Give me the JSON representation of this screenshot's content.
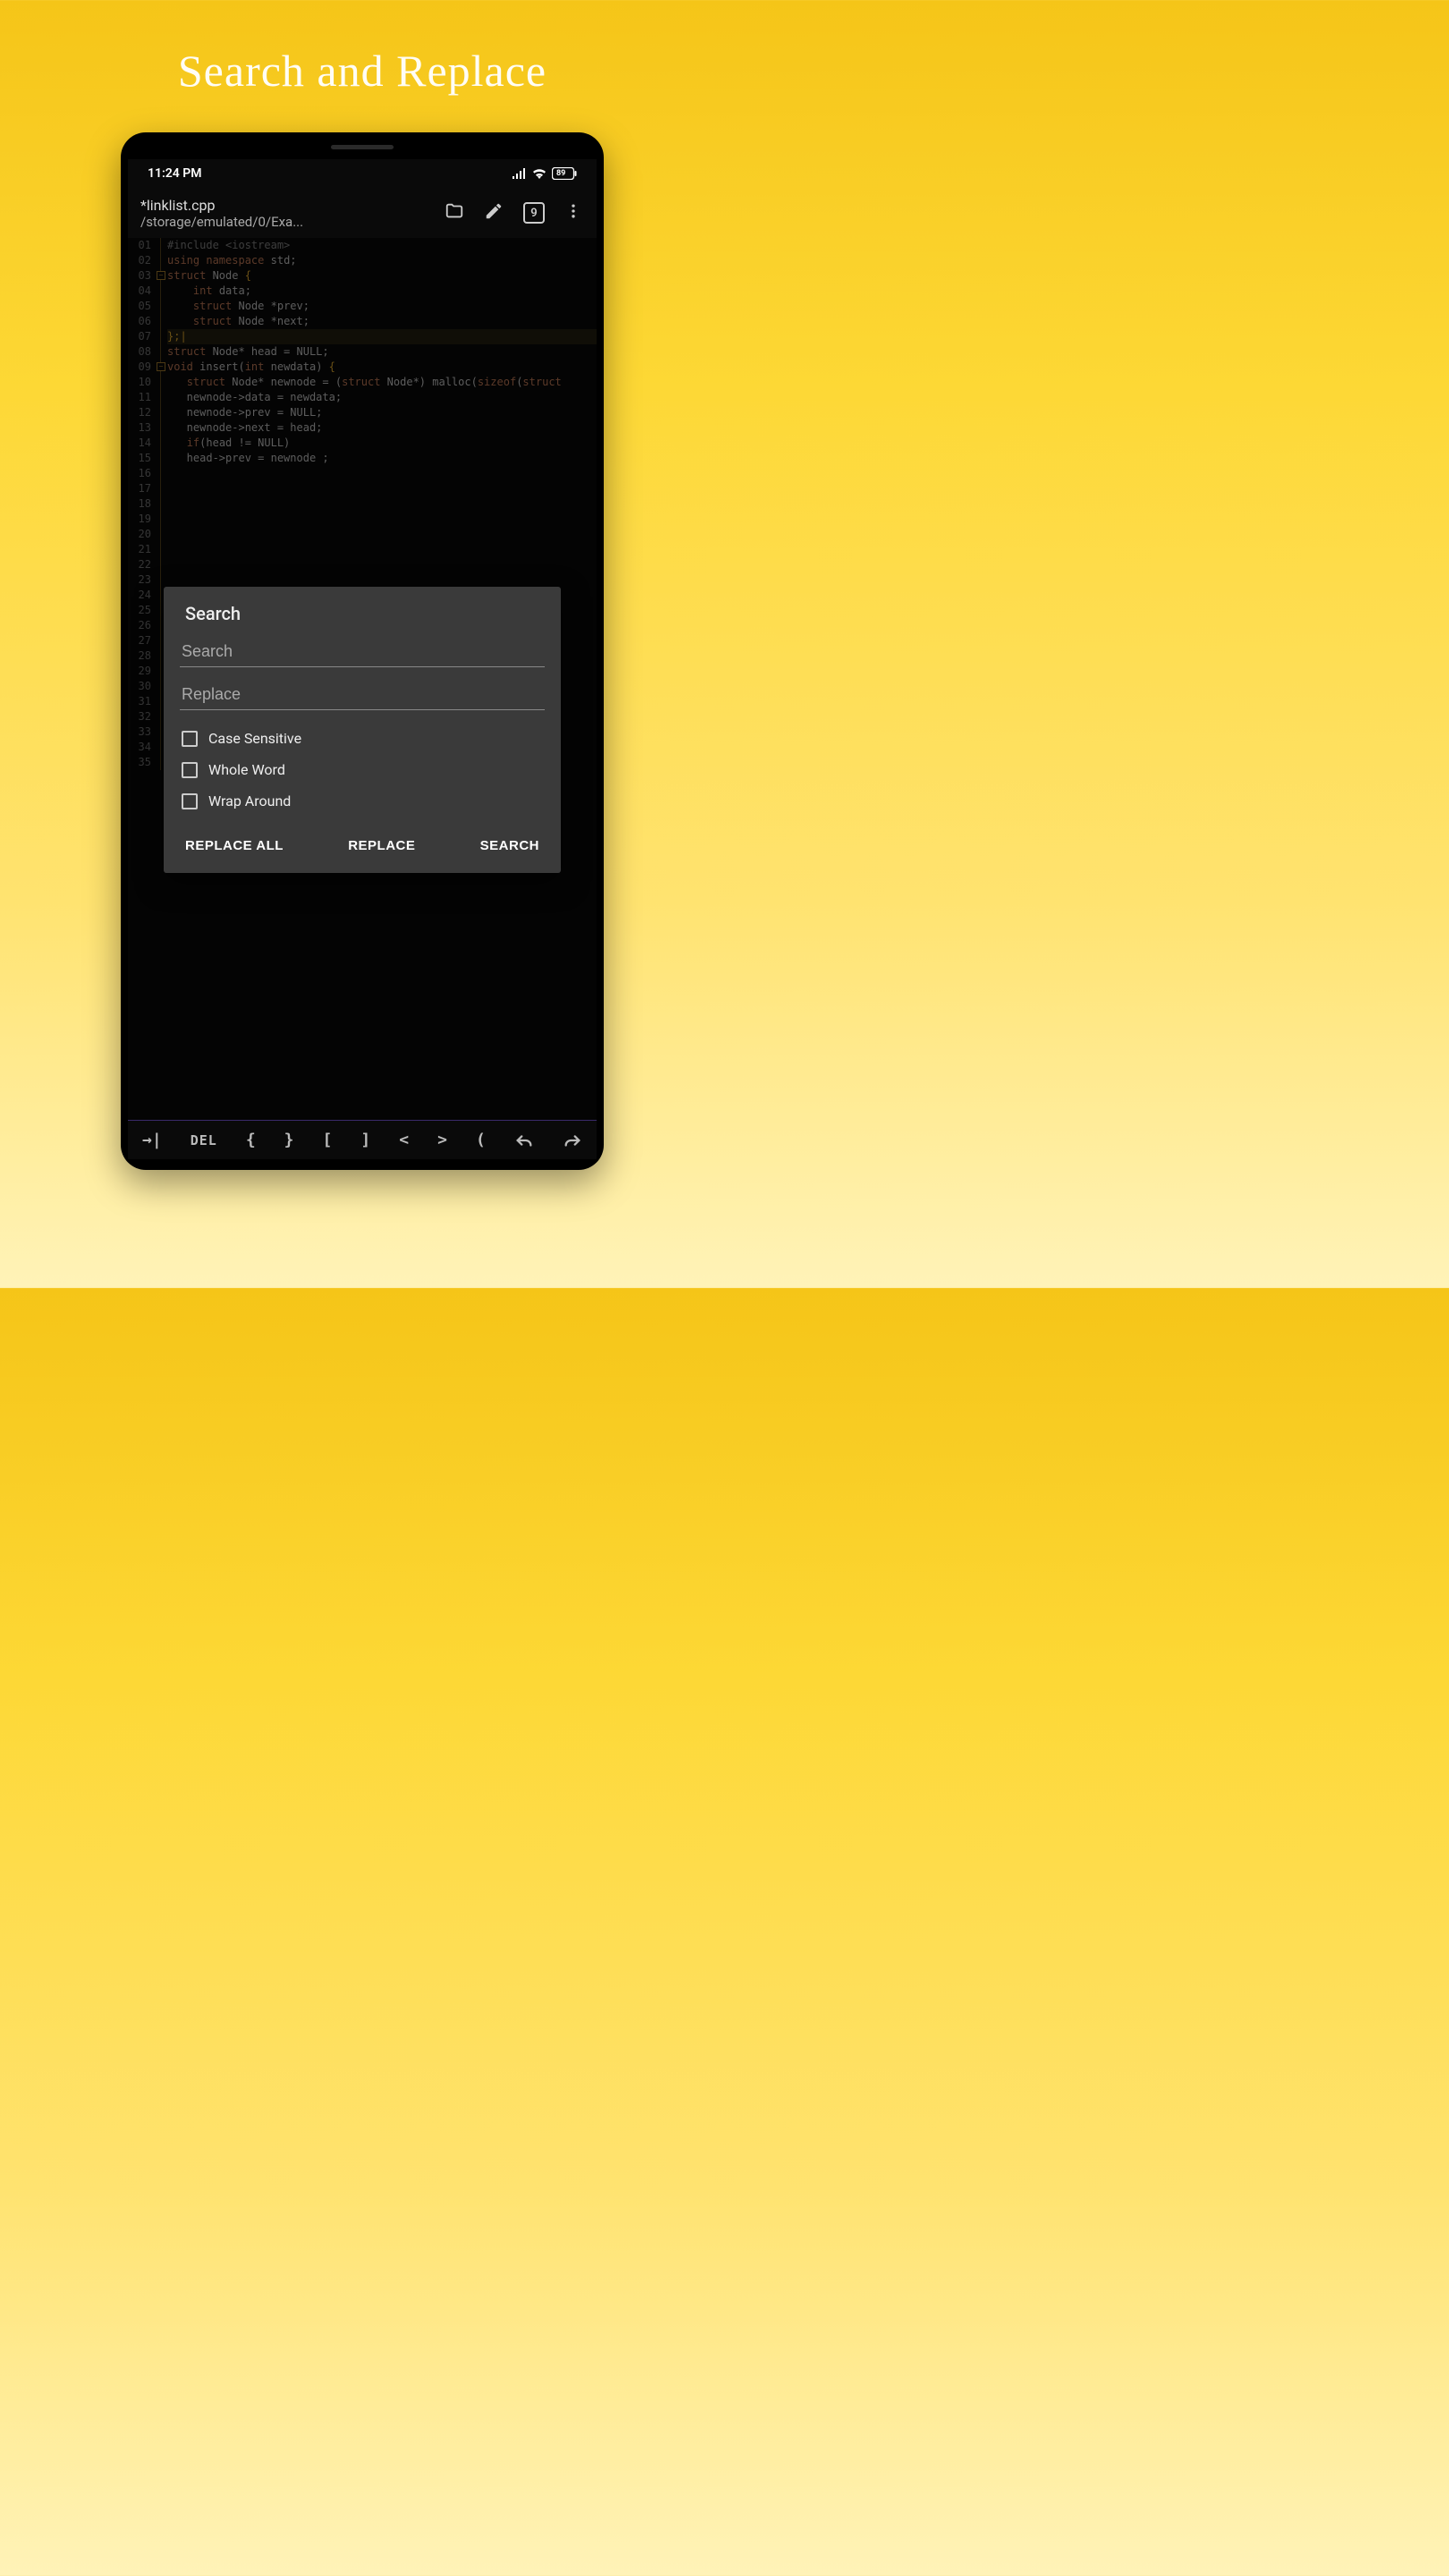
{
  "page": {
    "title": "Search and Replace"
  },
  "status": {
    "time": "11:24 PM",
    "battery": "89"
  },
  "appbar": {
    "file_name": "*linklist.cpp",
    "file_path": "/storage/emulated/0/Exa...",
    "tab_count": "9"
  },
  "code": {
    "lines": [
      {
        "n": "01",
        "html": "<span class='pp'>#include</span> <span class='inc'>&lt;iostream&gt;</span>"
      },
      {
        "n": "02",
        "html": "<span class='ns'>using</span> <span class='ns'>namespace</span> std;"
      },
      {
        "n": "03",
        "html": "<span class='kw'>struct</span> Node <span class='brace'>{</span>",
        "fold": true
      },
      {
        "n": "04",
        "html": "    <span class='kw'>int</span> data;"
      },
      {
        "n": "05",
        "html": "    <span class='kw'>struct</span> Node *prev;"
      },
      {
        "n": "06",
        "html": "    <span class='kw'>struct</span> Node *next;"
      },
      {
        "n": "07",
        "html": "<span class='brace'>};</span><span class='cur'>|</span>",
        "highlight": true
      },
      {
        "n": "08",
        "html": "<span class='kw'>struct</span> Node* head = NULL;"
      },
      {
        "n": "09",
        "html": "<span class='kw'>void</span> insert(<span class='kw'>int</span> newdata) <span class='brace'>{</span>",
        "fold": true
      },
      {
        "n": "10",
        "html": "   <span class='kw'>struct</span> Node* newnode = (<span class='kw'>struct</span> Node*) malloc(<span class='kw'>sizeof</span>(<span class='kw'>struct</span>"
      },
      {
        "n": "11",
        "html": "   newnode-&gt;data = newdata;"
      },
      {
        "n": "12",
        "html": "   newnode-&gt;prev = NULL;"
      },
      {
        "n": "13",
        "html": "   newnode-&gt;next = head;"
      },
      {
        "n": "14",
        "html": "   <span class='kw'>if</span>(head != NULL)"
      },
      {
        "n": "15",
        "html": "   head-&gt;prev = newnode ;"
      },
      {
        "n": "16",
        "html": ""
      },
      {
        "n": "17",
        "html": ""
      },
      {
        "n": "18",
        "html": ""
      },
      {
        "n": "19",
        "html": ""
      },
      {
        "n": "20",
        "html": ""
      },
      {
        "n": "21",
        "html": ""
      },
      {
        "n": "22",
        "html": ""
      },
      {
        "n": "23",
        "html": ""
      },
      {
        "n": "24",
        "html": ""
      },
      {
        "n": "25",
        "html": ""
      },
      {
        "n": "26",
        "html": ""
      },
      {
        "n": "27",
        "html": ""
      },
      {
        "n": "28",
        "html": ""
      },
      {
        "n": "29",
        "html": ""
      },
      {
        "n": "30",
        "html": ""
      },
      {
        "n": "31",
        "html": ""
      },
      {
        "n": "32",
        "html": ""
      },
      {
        "n": "33",
        "html": ""
      },
      {
        "n": "34",
        "html": ""
      },
      {
        "n": "35",
        "html": ""
      }
    ]
  },
  "dialog": {
    "title": "Search",
    "search_placeholder": "Search",
    "replace_placeholder": "Replace",
    "opt_case": "Case Sensitive",
    "opt_word": "Whole Word",
    "opt_wrap": "Wrap Around",
    "btn_replace_all": "REPLACE ALL",
    "btn_replace": "REPLACE",
    "btn_search": "SEARCH"
  },
  "bottom": {
    "tab": "→|",
    "del": "DEL",
    "k1": "{",
    "k2": "}",
    "k3": "[",
    "k4": "]",
    "k5": "<",
    "k6": ">",
    "k7": "("
  }
}
